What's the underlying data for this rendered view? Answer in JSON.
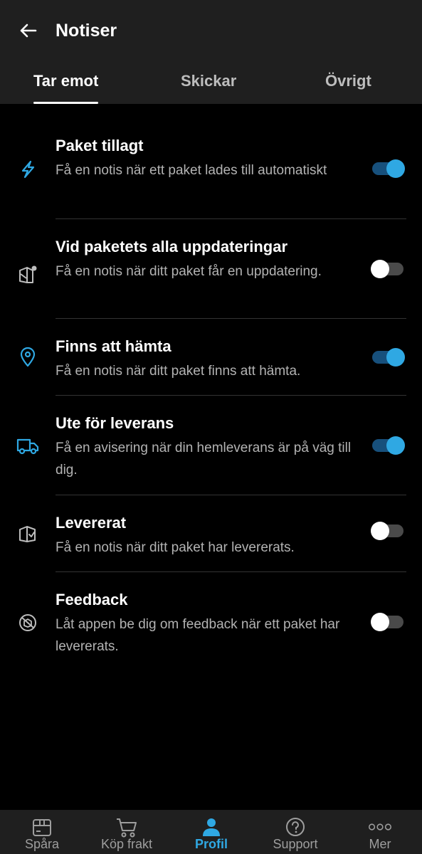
{
  "header": {
    "title": "Notiser",
    "back_icon": "arrow-left-icon"
  },
  "tabs": [
    {
      "label": "Tar emot",
      "active": true
    },
    {
      "label": "Skickar",
      "active": false
    },
    {
      "label": "Övrigt",
      "active": false
    }
  ],
  "notifications": [
    {
      "icon": "lightning-icon",
      "title": "Paket tillagt",
      "description": "Få en notis när ett paket lades till automatiskt",
      "enabled": true
    },
    {
      "icon": "package-update-icon",
      "title": "Vid paketets alla uppdateringar",
      "description": "Få en notis när ditt paket får en uppdatering.",
      "enabled": false
    },
    {
      "icon": "location-pin-icon",
      "title": "Finns att hämta",
      "description": "Få en notis när ditt paket finns att hämta.",
      "enabled": true
    },
    {
      "icon": "delivery-truck-icon",
      "title": "Ute för leverans",
      "description": "Få en avisering när din hemleverans är på väg till dig.",
      "enabled": true
    },
    {
      "icon": "package-delivered-icon",
      "title": "Levererat",
      "description": "Få en notis när ditt paket har levererats.",
      "enabled": false
    },
    {
      "icon": "feedback-icon",
      "title": "Feedback",
      "description": "Låt appen be dig om feedback när ett paket har levererats.",
      "enabled": false
    }
  ],
  "bottom_nav": [
    {
      "label": "Spåra",
      "icon": "package-box-icon",
      "active": false
    },
    {
      "label": "Köp frakt",
      "icon": "shopping-cart-icon",
      "active": false
    },
    {
      "label": "Profil",
      "icon": "person-icon",
      "active": true
    },
    {
      "label": "Support",
      "icon": "help-circle-icon",
      "active": false
    },
    {
      "label": "Mer",
      "icon": "more-dots-icon",
      "active": false
    }
  ],
  "colors": {
    "accent": "#2fa8e3",
    "toggle_on_track": "#17507c",
    "background": "#000000",
    "header_bg": "#1f1f1f"
  }
}
